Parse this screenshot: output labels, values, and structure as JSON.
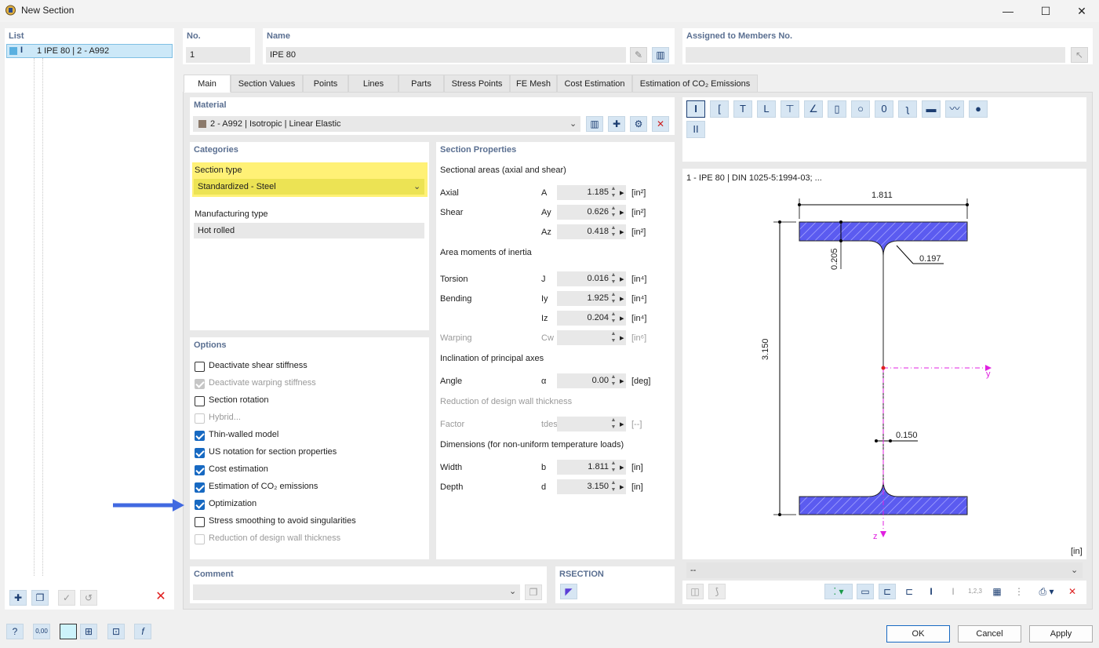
{
  "window": {
    "title": "New Section",
    "minimize": "—",
    "maximize": "☐",
    "close": "✕"
  },
  "list": {
    "label": "List",
    "items": [
      {
        "label": "1  IPE 80 | 2 - A992"
      }
    ]
  },
  "header": {
    "no_label": "No.",
    "no_value": "1",
    "name_label": "Name",
    "name_value": "IPE 80",
    "assigned_label": "Assigned to Members No.",
    "assigned_value": ""
  },
  "tabs": [
    {
      "label": "Main"
    },
    {
      "label": "Section Values"
    },
    {
      "label": "Points"
    },
    {
      "label": "Lines"
    },
    {
      "label": "Parts"
    },
    {
      "label": "Stress Points"
    },
    {
      "label": "FE Mesh"
    },
    {
      "label": "Cost Estimation"
    },
    {
      "label": "Estimation of CO₂ Emissions"
    }
  ],
  "material": {
    "label": "Material",
    "value": "2 - A992 | Isotropic | Linear Elastic",
    "swatch": "#8c7a6b"
  },
  "categories": {
    "label": "Categories",
    "section_type_label": "Section type",
    "section_type_value": "Standardized - Steel",
    "highlight": "#fff176",
    "manufacturing_label": "Manufacturing type",
    "manufacturing_value": "Hot rolled"
  },
  "options": {
    "label": "Options",
    "items": [
      {
        "label": "Deactivate shear stiffness",
        "state": "off"
      },
      {
        "label": "Deactivate warping stiffness",
        "state": "disabled-on"
      },
      {
        "label": "Section rotation",
        "state": "off"
      },
      {
        "label": "Hybrid...",
        "state": "disabled"
      },
      {
        "label": "Thin-walled model",
        "state": "on"
      },
      {
        "label": "US notation for section properties",
        "state": "on"
      },
      {
        "label": "Cost estimation",
        "state": "on"
      },
      {
        "label": "Estimation of CO₂ emissions",
        "state": "on"
      },
      {
        "label": "Optimization",
        "state": "on"
      },
      {
        "label": "Stress smoothing to avoid singularities",
        "state": "off"
      },
      {
        "label": "Reduction of design wall thickness",
        "state": "disabled"
      }
    ]
  },
  "section_properties": {
    "label": "Section Properties",
    "groups": {
      "areas": "Sectional areas (axial and shear)",
      "inertia": "Area moments of inertia",
      "principal": "Inclination of principal axes",
      "reduction": "Reduction of design wall thickness",
      "dimensions": "Dimensions (for non-uniform temperature loads)"
    },
    "rows": [
      {
        "name": "Axial",
        "symbol": "A",
        "value": "1.185",
        "unit": "[in²]"
      },
      {
        "name": "Shear",
        "symbol": "Ay",
        "value": "0.626",
        "unit": "[in²]"
      },
      {
        "name": "",
        "symbol": "Az",
        "value": "0.418",
        "unit": "[in²]"
      },
      {
        "name": "Torsion",
        "symbol": "J",
        "value": "0.016",
        "unit": "[in⁴]"
      },
      {
        "name": "Bending",
        "symbol": "Iy",
        "value": "1.925",
        "unit": "[in⁴]"
      },
      {
        "name": "",
        "symbol": "Iz",
        "value": "0.204",
        "unit": "[in⁴]"
      },
      {
        "name": "Warping",
        "symbol": "Cw",
        "value": "",
        "unit": "[in⁶]"
      },
      {
        "name": "Angle",
        "symbol": "α",
        "value": "0.00",
        "unit": "[deg]"
      },
      {
        "name": "Factor",
        "symbol": "tdes/t",
        "value": "",
        "unit": "[--]"
      },
      {
        "name": "Width",
        "symbol": "b",
        "value": "1.811",
        "unit": "[in]"
      },
      {
        "name": "Depth",
        "symbol": "d",
        "value": "3.150",
        "unit": "[in]"
      }
    ]
  },
  "preview": {
    "caption": "1 - IPE 80 | DIN 1025-5:1994-03; ...",
    "dim_width": "1.811",
    "dim_depth": "3.150",
    "dim_flange": "0.205",
    "dim_radius": "0.197",
    "dim_web": "0.150",
    "axis_y": "y",
    "axis_z": "z",
    "unit": "[in]",
    "dropdown_value": "--",
    "hatch_color": "#5b5bf0"
  },
  "comment": {
    "label": "Comment",
    "value": ""
  },
  "rsection": {
    "label": "RSECTION"
  },
  "footer": {
    "ok": "OK",
    "cancel": "Cancel",
    "apply": "Apply"
  }
}
